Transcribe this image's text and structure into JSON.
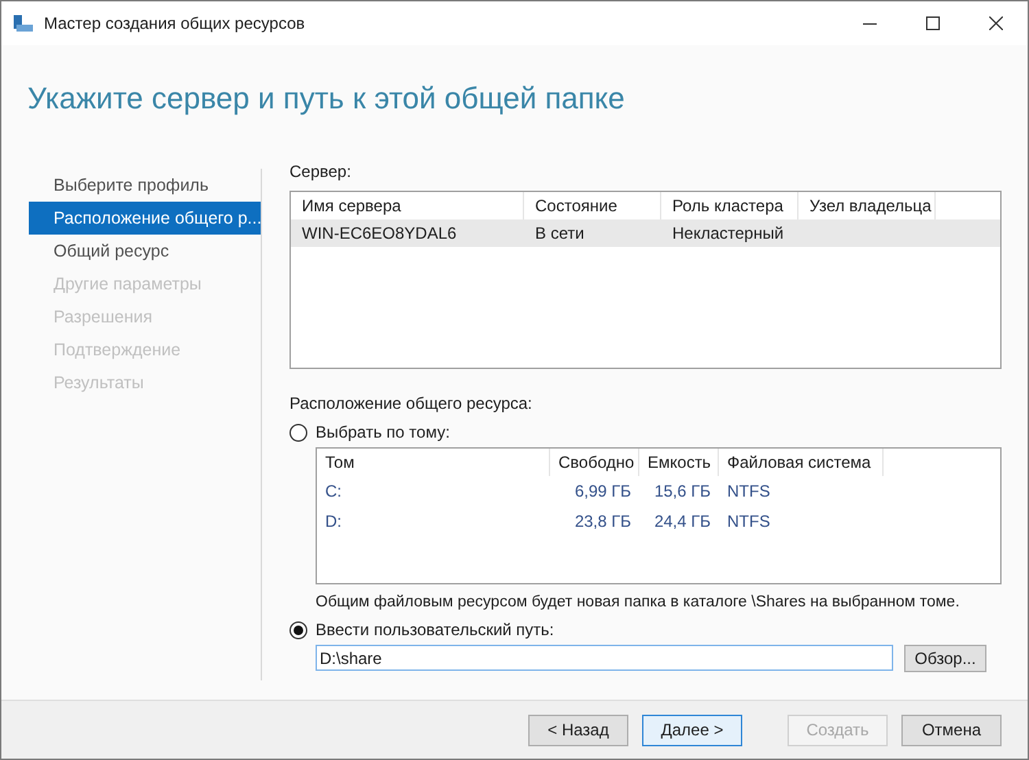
{
  "window": {
    "title": "Мастер создания общих ресурсов"
  },
  "heading": "Укажите сервер и путь к этой общей папке",
  "steps": [
    {
      "label": "Выберите профиль",
      "selected": false,
      "disabled": false
    },
    {
      "label": "Расположение общего р...",
      "selected": true,
      "disabled": false
    },
    {
      "label": "Общий ресурс",
      "selected": false,
      "disabled": false
    },
    {
      "label": "Другие параметры",
      "selected": false,
      "disabled": true
    },
    {
      "label": "Разрешения",
      "selected": false,
      "disabled": true
    },
    {
      "label": "Подтверждение",
      "selected": false,
      "disabled": true
    },
    {
      "label": "Результаты",
      "selected": false,
      "disabled": true
    }
  ],
  "server": {
    "label": "Сервер:",
    "columns": [
      "Имя сервера",
      "Состояние",
      "Роль кластера",
      "Узел владельца"
    ],
    "rows": [
      {
        "cells": [
          "WIN-EC6EO8YDAL6",
          "В сети",
          "Некластерный",
          ""
        ],
        "selected": true
      }
    ]
  },
  "location_label": "Расположение общего ресурса:",
  "options": [
    {
      "label": "Выбрать по тому:",
      "selected": false
    },
    {
      "label": "Ввести пользовательский путь:",
      "selected": true
    }
  ],
  "volumes": {
    "columns": [
      "Том",
      "Свободно",
      "Емкость",
      "Файловая система"
    ],
    "rows": [
      [
        "C:",
        "6,99 ГБ",
        "15,6 ГБ",
        "NTFS"
      ],
      [
        "D:",
        "23,8 ГБ",
        "24,4 ГБ",
        "NTFS"
      ]
    ]
  },
  "note": "Общим файловым ресурсом будет новая папка в каталоге \\Shares на выбранном томе.",
  "path": {
    "value": "D:\\share"
  },
  "browse_button": "Обзор...",
  "buttons": [
    {
      "label": "< Назад",
      "disabled": false,
      "default": false
    },
    {
      "label": "Далее >",
      "disabled": false,
      "default": true
    },
    {
      "label": "Создать",
      "disabled": true,
      "default": false
    },
    {
      "label": "Отмена",
      "disabled": false,
      "default": false
    }
  ]
}
